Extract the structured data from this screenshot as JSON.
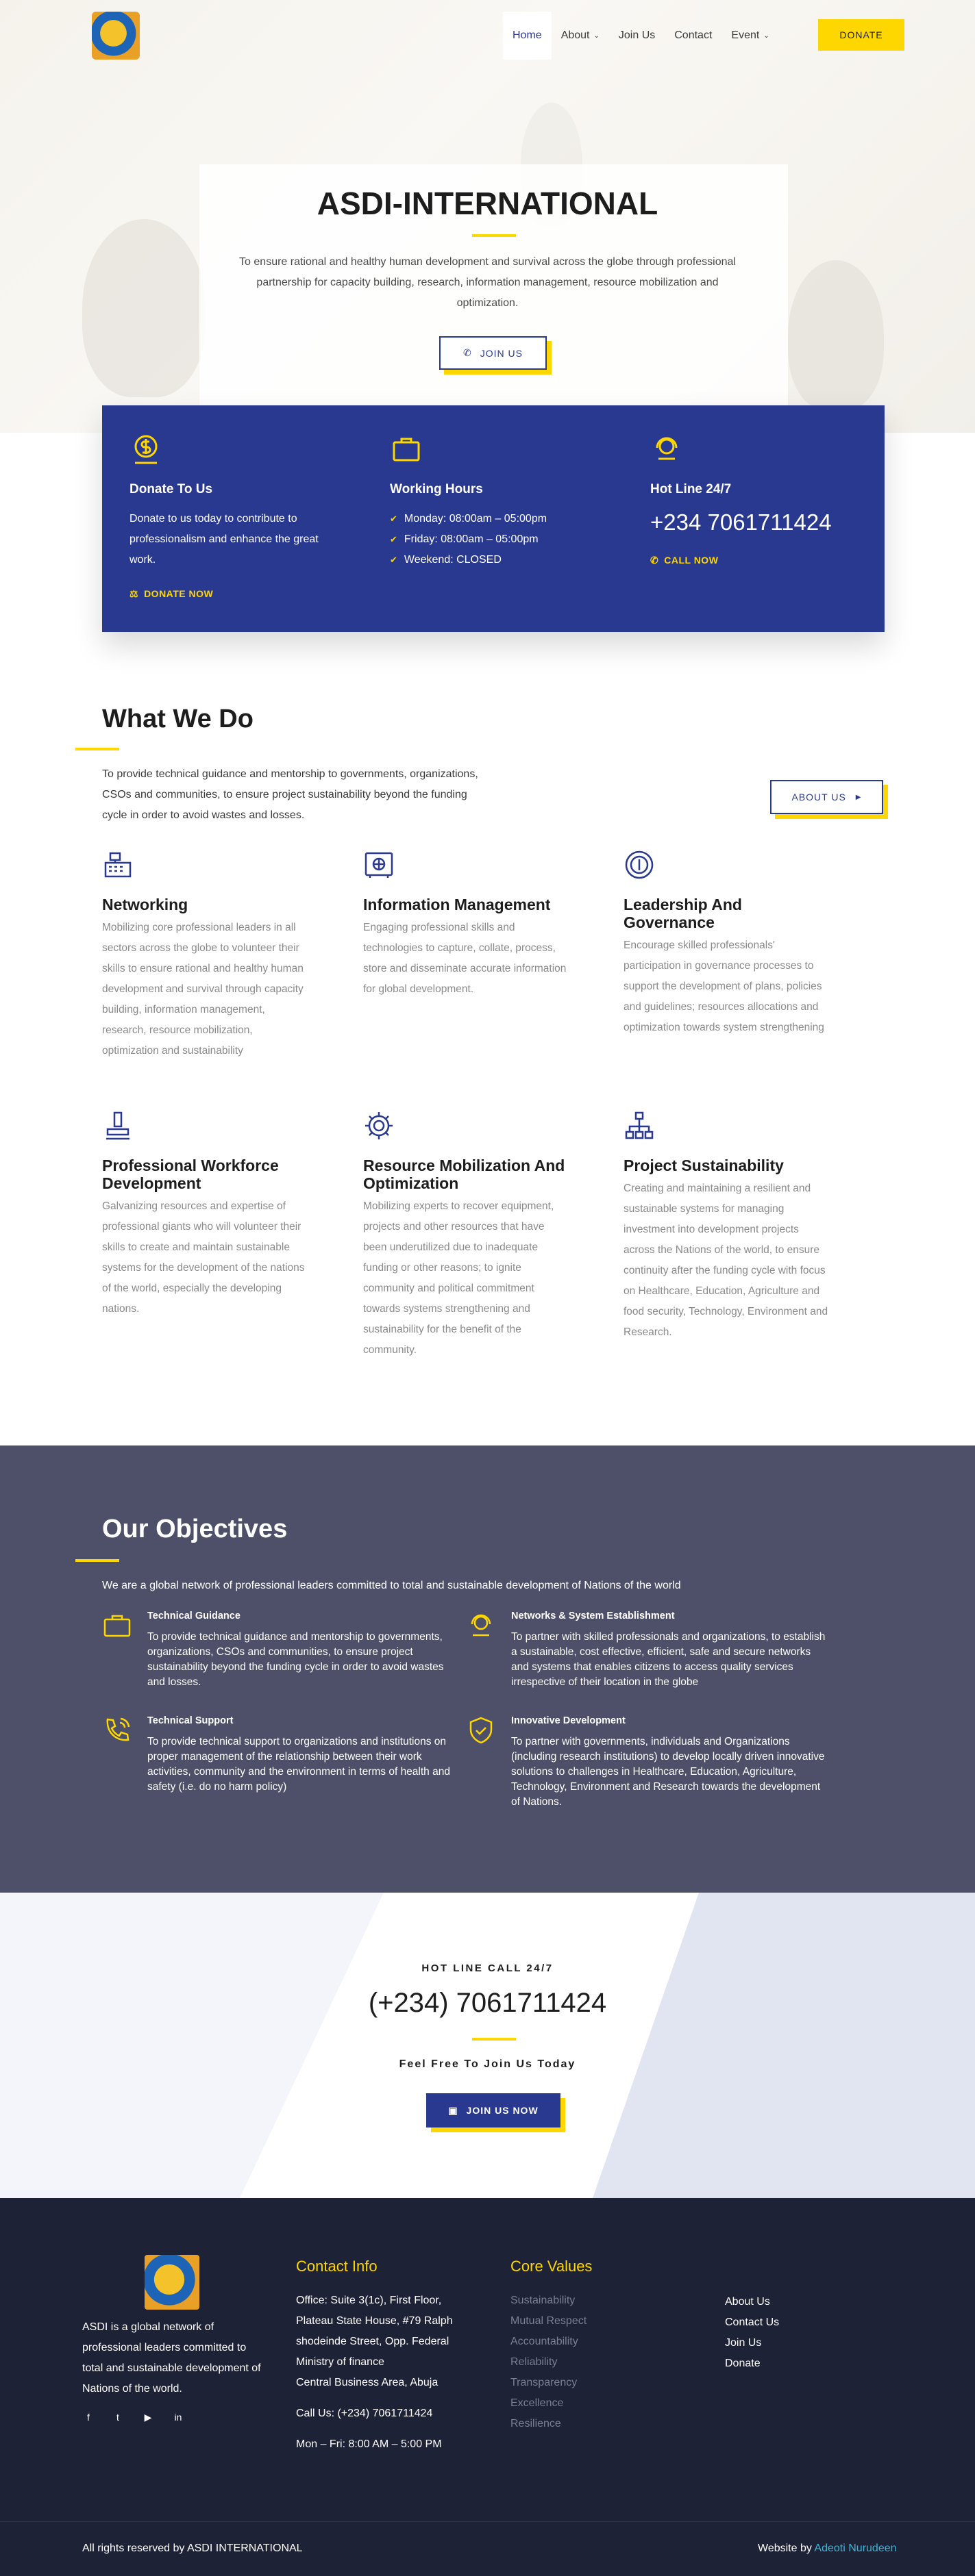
{
  "header": {
    "nav": [
      {
        "label": "Home"
      },
      {
        "label": "About",
        "dropdown": true
      },
      {
        "label": "Join Us"
      },
      {
        "label": "Contact"
      },
      {
        "label": "Event",
        "dropdown": true
      }
    ],
    "donate_label": "DONATE"
  },
  "hero": {
    "title": "ASDI-INTERNATIONAL",
    "description": "To ensure rational and healthy human development and survival across the globe through professional partnership for capacity building, research, information management, resource mobilization and optimization.",
    "join_label": "JOIN US"
  },
  "info": {
    "donate": {
      "icon": "dollar-bag-icon",
      "title": "Donate To Us",
      "text": "Donate to us today to contribute to professionalism and enhance the great work.",
      "link": "DONATE NOW"
    },
    "hours": {
      "icon": "briefcase-icon",
      "title": "Working Hours",
      "items": [
        "Monday: 08:00am – 05:00pm",
        "Friday: 08:00am – 05:00pm",
        "Weekend: CLOSED"
      ]
    },
    "hotline": {
      "icon": "headset-icon",
      "title": "Hot Line 24/7",
      "phone": "+234 7061711424",
      "link": "CALL NOW"
    }
  },
  "what_we_do": {
    "title": "What We Do",
    "description": "To provide technical guidance and mentorship to governments, organizations, CSOs and communities, to ensure project sustainability beyond the funding cycle in order to avoid wastes and losses.",
    "about_label": "ABOUT US",
    "services": [
      {
        "icon": "cash-register-icon",
        "title": "Networking",
        "text": "Mobilizing core professional leaders in all sectors across the globe to volunteer their skills to ensure rational and healthy human development and survival through capacity building, information management, research, resource mobilization, optimization and sustainability"
      },
      {
        "icon": "safe-icon",
        "title": "Information Management",
        "text": "Engaging professional skills and technologies to capture, collate, process, store and disseminate accurate information for global development."
      },
      {
        "icon": "coin-icon",
        "title": "Leadership And Governance",
        "text": "Encourage skilled professionals' participation in governance processes to support the development of plans, policies and guidelines; resources allocations and optimization towards system strengthening"
      },
      {
        "icon": "stamp-icon",
        "title": "Professional Workforce Development",
        "text": "Galvanizing resources and expertise of professional giants who will volunteer their skills to create and maintain sustainable systems for the development of the nations of the world, especially the developing nations."
      },
      {
        "icon": "gear-icon",
        "title": "Resource Mobilization And Optimization",
        "text": "Mobilizing experts to recover equipment, projects and other resources that have been underutilized due to inadequate funding or other reasons; to ignite community and political commitment towards systems strengthening and sustainability for the benefit of the community."
      },
      {
        "icon": "org-chart-icon",
        "title": "Project Sustainability",
        "text": "Creating and maintaining a resilient and sustainable systems for managing investment into development projects across the Nations of the world, to ensure continuity after the funding cycle with focus on Healthcare, Education, Agriculture and food security, Technology, Environment and Research."
      }
    ]
  },
  "objectives": {
    "title": "Our Objectives",
    "description": "We are a global network of professional leaders committed to total and sustainable development of Nations of the world",
    "items": [
      {
        "icon": "briefcase-icon",
        "title": "Technical Guidance",
        "text": "To provide technical guidance and mentorship to governments, organizations, CSOs and communities, to ensure project sustainability beyond the funding cycle in order to avoid wastes and losses."
      },
      {
        "icon": "headset-icon",
        "title": "Networks & System Establishment",
        "text": "To partner with skilled professionals and organizations, to establish a sustainable, cost effective, efficient, safe and secure networks and systems that enables citizens to access quality services irrespective of their location in the globe"
      },
      {
        "icon": "phone-icon",
        "title": "Technical Support",
        "text": "To provide technical support to organizations and institutions on proper management of the relationship between their work activities, community and the environment in terms of health and safety (i.e. do no harm policy)"
      },
      {
        "icon": "shield-icon",
        "title": "Innovative Development",
        "text": "To partner with governments, individuals and Organizations (including research institutions) to develop locally driven innovative solutions to challenges in Healthcare, Education, Agriculture, Technology, Environment and Research towards the development of Nations."
      }
    ]
  },
  "hotline_section": {
    "label": "HOT LINE CALL 24/7",
    "phone": "(+234) 7061711424",
    "cta": "Feel Free To Join Us Today",
    "button": "JOIN US NOW"
  },
  "footer": {
    "about": "ASDI is a global network of professional leaders committed to total and sustainable development of Nations of the world.",
    "contact_title": "Contact Info",
    "address": "Office: Suite 3(1c), First Floor, Plateau State House, #79 Ralph shodeinde Street, Opp. Federal Ministry of finance",
    "address2": "Central Business Area, Abuja",
    "call": "Call Us: (+234) 7061711424",
    "hours": "Mon – Fri: 8:00 AM – 5:00 PM",
    "values_title": "Core Values",
    "values": [
      "Sustainability",
      "Mutual Respect",
      "Accountability",
      "Reliability",
      "Transparency",
      "Excellence",
      "Resilience"
    ],
    "links": [
      "About Us",
      "Contact Us",
      "Join Us",
      "Donate"
    ],
    "copyright": "All rights reserved by  ASDI INTERNATIONAL",
    "credit_prefix": "Website by ",
    "credit_name": "Adeoti Nurudeen"
  },
  "colors": {
    "brand_blue": "#2a3990",
    "accent_yellow": "#ffd700",
    "objectives_bg": "#4d5068",
    "footer_bg": "#1e2237"
  }
}
